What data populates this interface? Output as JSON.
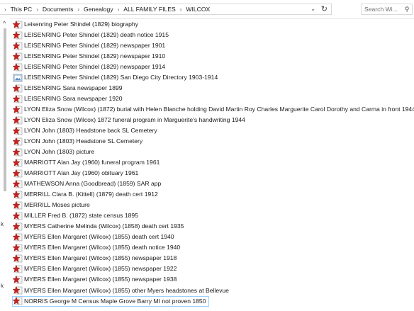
{
  "address_bar": {
    "breadcrumbs": [
      "This PC",
      "Documents",
      "Genealogy",
      "ALL FAMILY FILES",
      "WILCOX"
    ],
    "search_placeholder": "Search Wi..."
  },
  "files": [
    {
      "name": "Leisenring Peter Shindel (1829) biography",
      "icon": "starred-document-icon"
    },
    {
      "name": "LEISENRING Peter Shindel (1829) death notice 1915",
      "icon": "starred-document-icon"
    },
    {
      "name": "LEISENRING Peter Shindel (1829) newspaper 1901",
      "icon": "starred-document-icon"
    },
    {
      "name": "LEISENRING Peter Shindel (1829) newspaper 1910",
      "icon": "starred-document-icon"
    },
    {
      "name": "LEISENRING Peter Shindel (1829) newspaper 1914",
      "icon": "starred-document-icon"
    },
    {
      "name": "LEISENRING Peter Shindel (1829) San Diego City Directory 1903-1914",
      "icon": "image-file-icon"
    },
    {
      "name": "LEISENRING Sara newspaper 1899",
      "icon": "starred-document-icon"
    },
    {
      "name": "LEISENRING Sara newspaper 1920",
      "icon": "starred-document-icon"
    },
    {
      "name": "LYON Eliza Snow (Wilcox) (1872) burial with Helen Blanche holding David Martin Roy Charles Marguerite Carol Dorothy and Carma in front 1944",
      "icon": "starred-document-icon"
    },
    {
      "name": "LYON Eliza Snow (Wilcox) 1872 funeral program in Marguerite's handwriting 1944",
      "icon": "starred-document-icon"
    },
    {
      "name": "LYON John (1803) Headstone back SL Cemetery",
      "icon": "starred-document-icon"
    },
    {
      "name": "LYON John (1803) Headstone SL Cemetery",
      "icon": "starred-document-icon"
    },
    {
      "name": "LYON John (1803) picture",
      "icon": "starred-document-icon"
    },
    {
      "name": "MARRIOTT Alan Jay (1960) funeral program 1961",
      "icon": "starred-document-icon"
    },
    {
      "name": "MARRIOTT Alan Jay (1960) obituary 1961",
      "icon": "starred-document-icon"
    },
    {
      "name": "MATHEWSON Anna (Goodbread) (1859) SAR app",
      "icon": "starred-document-icon"
    },
    {
      "name": "MERRILL Clara B. (Kittell) (1879) death cert 1912",
      "icon": "starred-document-icon"
    },
    {
      "name": "MERRILL Moses picture",
      "icon": "starred-document-icon"
    },
    {
      "name": "MILLER Fred B. (1872) state census 1895",
      "icon": "starred-document-icon"
    },
    {
      "name": "MYERS Catherine Melinda (Wilcox) (1858) death cert 1935",
      "icon": "starred-document-icon"
    },
    {
      "name": "MYERS Ellen Margaret (Wilcox) (1855) death cert 1940",
      "icon": "starred-document-icon"
    },
    {
      "name": "MYERS Ellen Margaret (Wilcox) (1855) death notice 1940",
      "icon": "starred-document-icon"
    },
    {
      "name": "MYERS Ellen Margaret (Wilcox) (1855) newspaper 1918",
      "icon": "starred-document-icon"
    },
    {
      "name": "MYERS Ellen Margaret (Wilcox) (1855) newspaper 1922",
      "icon": "starred-document-icon"
    },
    {
      "name": "MYERS Ellen Margaret (Wilcox) (1855) newspaper 1938",
      "icon": "starred-document-icon"
    },
    {
      "name": "MYERS Ellen Margaret (Wilcox) (1855) other Myers headstones at Bellevue",
      "icon": "starred-document-icon"
    },
    {
      "name": "NORRIS George M  Census Maple Grove Barry MI not proven 1850",
      "icon": "starred-document-icon",
      "selected": true
    }
  ],
  "nav_pane_fragments": [
    "k",
    "k"
  ]
}
